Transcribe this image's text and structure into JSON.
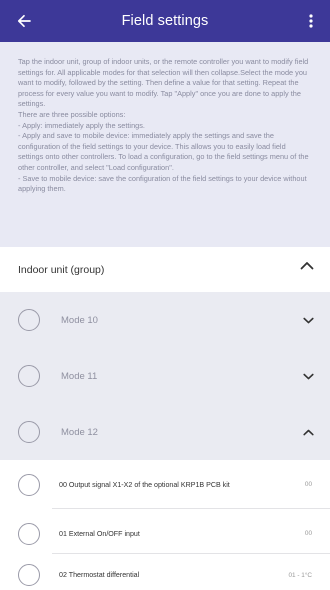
{
  "app_bar": {
    "title": "Field settings",
    "background": "#3d3898"
  },
  "info_text": [
    "Tap the indoor unit, group of indoor units, or the remote controller you want to modify field settings for. All applicable modes for that selection will then collapse.Select the mode you want to modify, followed by the setting. Then define a value for that setting. Repeat the process for every value you want to modify. Tap \"Apply\" once you are done to apply the settings.",
    "There are three possible options:",
    "- Apply: immediately apply the settings.",
    "- Apply and save to mobile device: immediately apply the settings and save the configuration of  the field settings to your device. This allows you to easily load field settings onto other controllers. To load a configuration, go to the field settings menu of the other controller, and select \"Load configuration\".",
    "- Save to mobile device: save the configuration of the field settings to your device without applying them."
  ],
  "group": {
    "label": "Indoor unit (group)",
    "expanded": true
  },
  "modes": [
    {
      "label": "Mode 10",
      "expanded": false
    },
    {
      "label": "Mode 11",
      "expanded": false
    },
    {
      "label": "Mode 12",
      "expanded": true
    }
  ],
  "settings": [
    {
      "label": "00 Output signal X1-X2 of the optional KRP1B PCB kit",
      "value": "00"
    },
    {
      "label": "01 External On/OFF input",
      "value": "00"
    },
    {
      "label": "02 Thermostat differential",
      "value": "01 - 1°C"
    }
  ]
}
